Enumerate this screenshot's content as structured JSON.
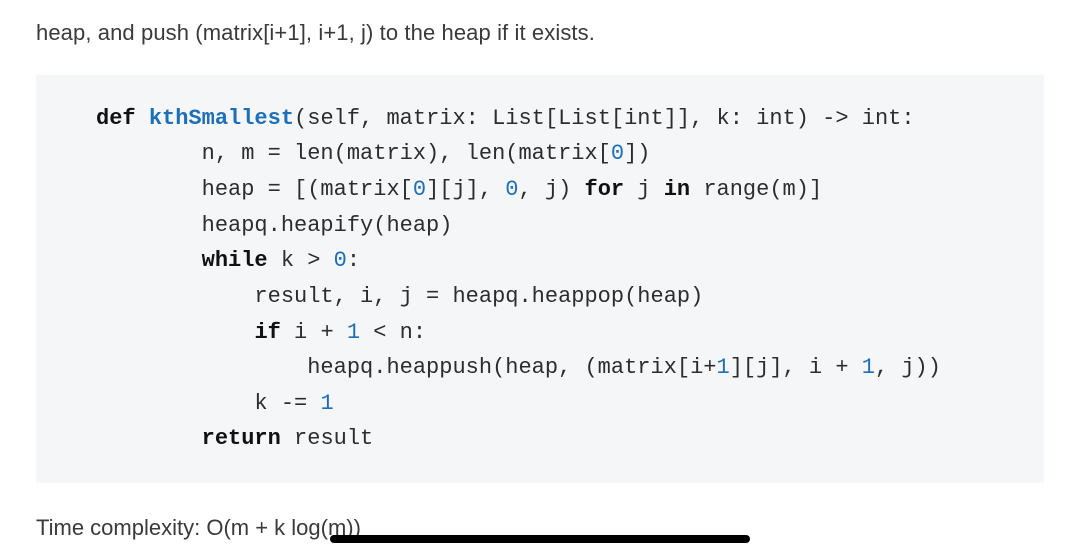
{
  "intro_text": "heap, and push (matrix[i+1], i+1, j) to the heap if it exists.",
  "code": {
    "l1_def": "def",
    "l1_fn": "kthSmallest",
    "l1_rest": "(self, matrix: List[List[int]], k: int) -> int:",
    "l2_a": "        n, m = len(matrix), len(matrix[",
    "l2_num1": "0",
    "l2_b": "])",
    "l3_a": "        heap = [(matrix[",
    "l3_num1": "0",
    "l3_b": "][j], ",
    "l3_num2": "0",
    "l3_c": ", j) ",
    "l3_for": "for",
    "l3_d": " j ",
    "l3_in": "in",
    "l3_e": " range(m)]",
    "l4": "        heapq.heapify(heap)",
    "l5_while": "while",
    "l5_rest": " k > ",
    "l5_num": "0",
    "l5_colon": ":",
    "l6": "            result, i, j = heapq.heappop(heap)",
    "l7_if": "if",
    "l7_a": " i + ",
    "l7_num": "1",
    "l7_b": " < n:",
    "l8_a": "                heapq.heappush(heap, (matrix[i+",
    "l8_num1": "1",
    "l8_b": "][j], i + ",
    "l8_num2": "1",
    "l8_c": ", j))",
    "l9_a": "            k -= ",
    "l9_num": "1",
    "l10_return": "return",
    "l10_rest": " result"
  },
  "complexity_text": "Time complexity: O(m + k log(m))"
}
